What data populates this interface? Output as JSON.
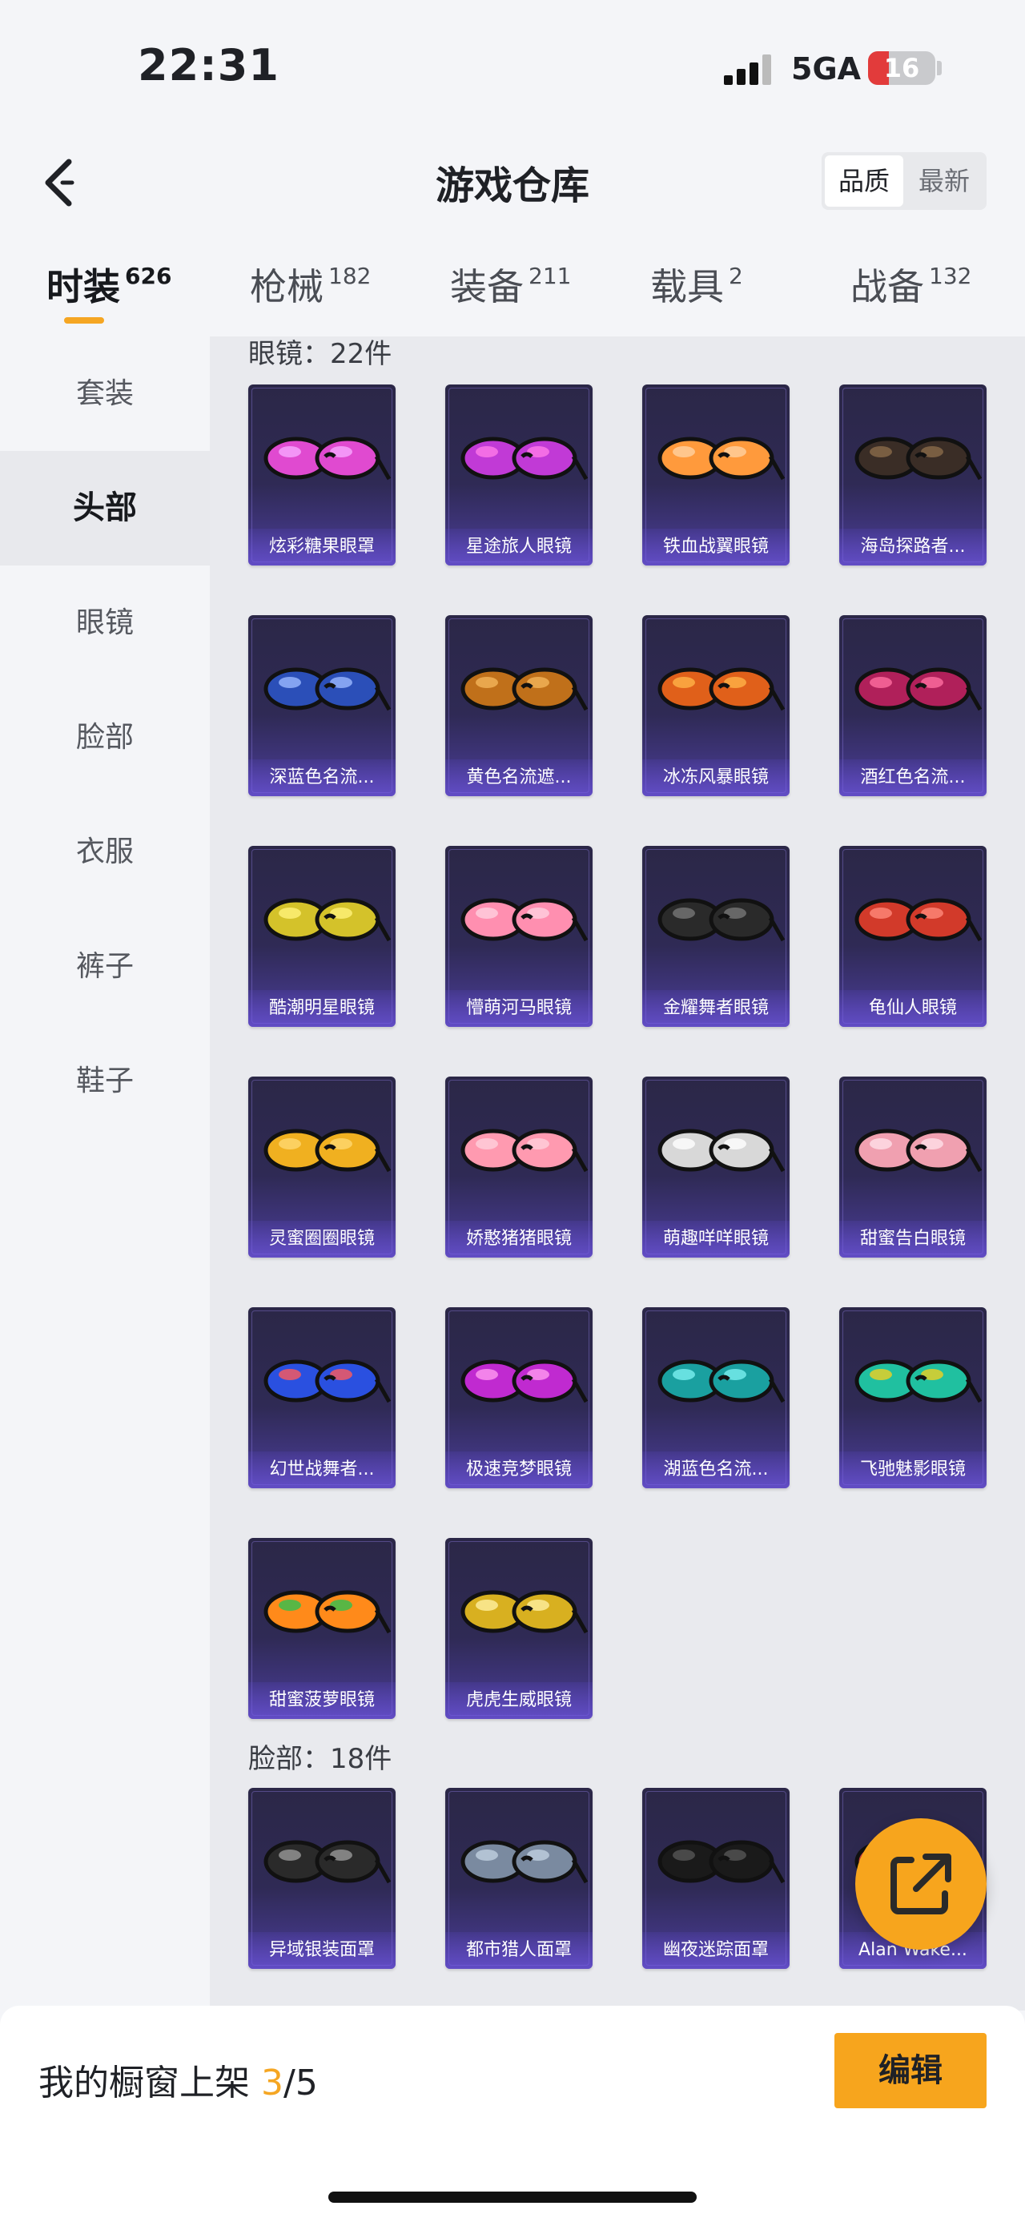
{
  "status": {
    "time": "22:31",
    "network": "5GA",
    "battery": "16"
  },
  "header": {
    "title": "游戏仓库",
    "sort_quality": "品质",
    "sort_newest": "最新"
  },
  "tabs": [
    {
      "label": "时装",
      "count": "626"
    },
    {
      "label": "枪械",
      "count": "182"
    },
    {
      "label": "装备",
      "count": "211"
    },
    {
      "label": "载具",
      "count": "2"
    },
    {
      "label": "战备",
      "count": "132"
    }
  ],
  "sidebar": {
    "items": [
      "套装",
      "头部",
      "眼镜",
      "脸部",
      "衣服",
      "裤子",
      "鞋子"
    ],
    "active": "头部"
  },
  "sections": [
    {
      "title": "眼镜：22件",
      "items": [
        "炫彩糖果眼罩",
        "星途旅人眼镜",
        "铁血战翼眼镜",
        "海岛探路者...",
        "深蓝色名流...",
        "黄色名流遮...",
        "冰冻风暴眼镜",
        "酒红色名流...",
        "酷潮明星眼镜",
        "懵萌河马眼镜",
        "金耀舞者眼镜",
        "龟仙人眼镜",
        "灵蜜圈圈眼镜",
        "娇憨猪猪眼镜",
        "萌趣咩咩眼镜",
        "甜蜜告白眼镜",
        "幻世战舞者...",
        "极速竞梦眼镜",
        "湖蓝色名流...",
        "飞驰魅影眼镜",
        "甜蜜菠萝眼镜",
        "虎虎生威眼镜"
      ]
    },
    {
      "title": "脸部：18件",
      "items": [
        "异域银装面罩",
        "都市猎人面罩",
        "幽夜迷踪面罩",
        "Alan Wake..."
      ]
    }
  ],
  "bottom": {
    "showcase_label": "我的橱窗上架",
    "showcase_current": "3",
    "showcase_total": "/5",
    "edit_label": "编辑"
  },
  "colors": {
    "accent": "#f7a51d",
    "card_bg": "#2f2a55",
    "card_label_bg": "#5a46c8"
  },
  "icons": {
    "back": "chevron-left-icon",
    "share": "external-link-icon"
  }
}
